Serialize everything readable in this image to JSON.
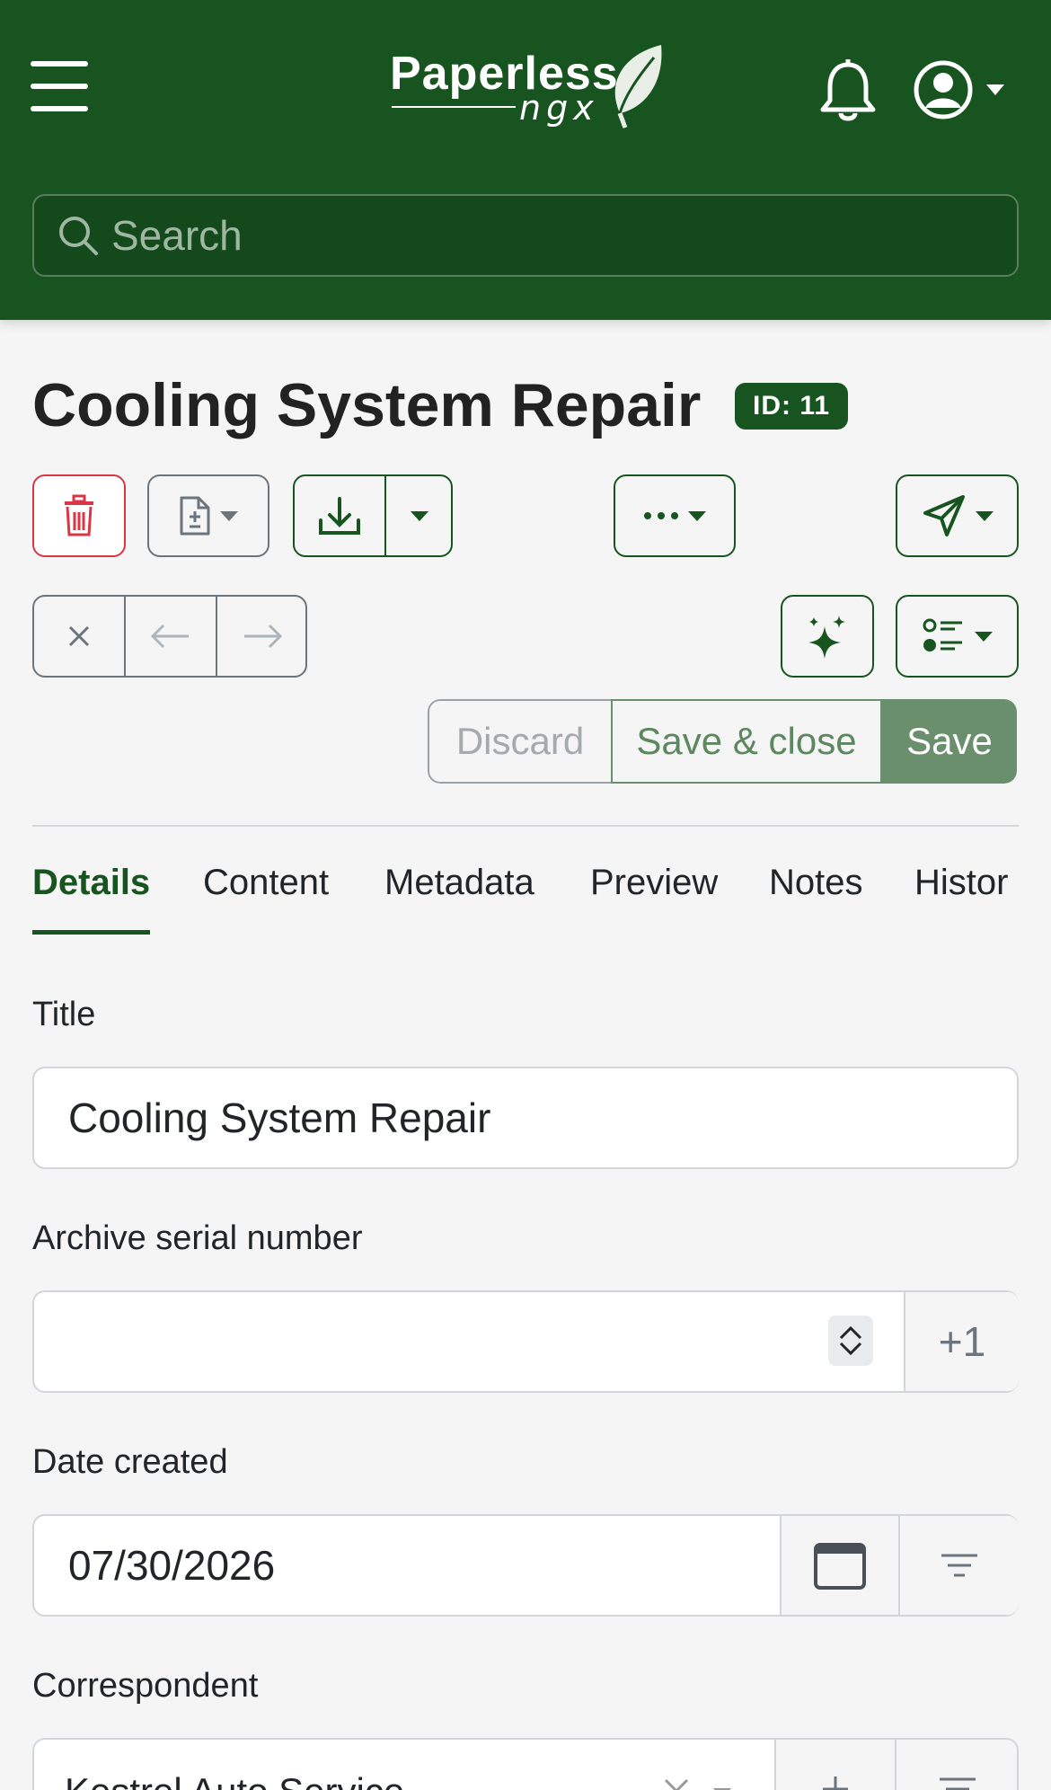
{
  "header": {
    "logo_text": "Paperless",
    "logo_sub": "ngx",
    "search_placeholder": "Search"
  },
  "document": {
    "title": "Cooling System Repair",
    "id_badge": "ID: 11"
  },
  "actions": {
    "discard_label": "Discard",
    "save_close_label": "Save & close",
    "save_label": "Save"
  },
  "tabs": [
    {
      "label": "Details",
      "active": true
    },
    {
      "label": "Content"
    },
    {
      "label": "Metadata"
    },
    {
      "label": "Preview"
    },
    {
      "label": "Notes"
    },
    {
      "label": "Histor"
    }
  ],
  "form": {
    "title_label": "Title",
    "title_value": "Cooling System Repair",
    "asn_label": "Archive serial number",
    "asn_value": "",
    "asn_increment": "+1",
    "date_label": "Date created",
    "date_value": "07/30/2026",
    "correspondent_label": "Correspondent",
    "correspondent_value": "Kestrel Auto Service"
  },
  "colors": {
    "primary": "#17541f",
    "danger": "#dc3545",
    "background": "#f4f5f4"
  }
}
